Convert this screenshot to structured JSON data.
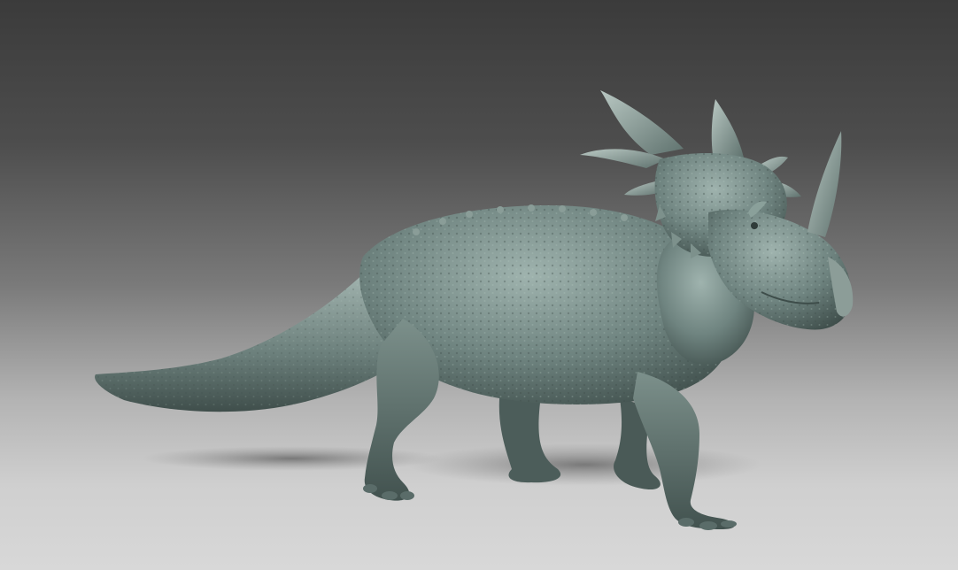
{
  "scene": {
    "subject": "styracosaurus-sculpt",
    "colors": {
      "background_top": "#3b3b3b",
      "background_bottom": "#d8d8d8",
      "body_mid": "#6f8480",
      "body_dark": "#3e4d4a",
      "body_light": "#9fb3ae",
      "shadow": "#6a6a6a"
    }
  }
}
